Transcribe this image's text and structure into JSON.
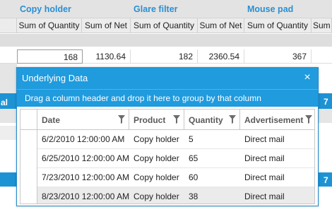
{
  "pivot": {
    "groups": [
      "Copy holder",
      "Glare filter",
      "Mouse pad"
    ],
    "measure_headers": [
      "Sum of Quantity",
      "Sum of Net",
      "Sum of Quantity",
      "Sum of Net",
      "Sum of Quantity",
      "Sum"
    ],
    "values_row": [
      "168",
      "1130.64",
      "182",
      "2360.54",
      "367"
    ],
    "left_label": "al",
    "right_digits": [
      "7",
      "7"
    ]
  },
  "dialog": {
    "title": "Underlying Data",
    "close_glyph": "×",
    "group_hint": "Drag a column header and drop it here to group by that column",
    "columns": [
      "Date",
      "Product",
      "Quantity",
      "Advertisement"
    ],
    "rows": [
      [
        "6/2/2010 12:00:00 AM",
        "Copy holder",
        "5",
        "Direct mail"
      ],
      [
        "6/25/2010 12:00:00 AM",
        "Copy holder",
        "65",
        "Direct mail"
      ],
      [
        "7/23/2010 12:00:00 AM",
        "Copy holder",
        "60",
        "Direct mail"
      ],
      [
        "8/23/2010 12:00:00 AM",
        "Copy holder",
        "38",
        "Direct mail"
      ]
    ]
  },
  "colors": {
    "accent": "#1f9bde",
    "group_text": "#2a8fd3",
    "alt_row": "#ebebeb"
  },
  "icons": {
    "filter": "funnel-icon",
    "close": "close-icon"
  }
}
